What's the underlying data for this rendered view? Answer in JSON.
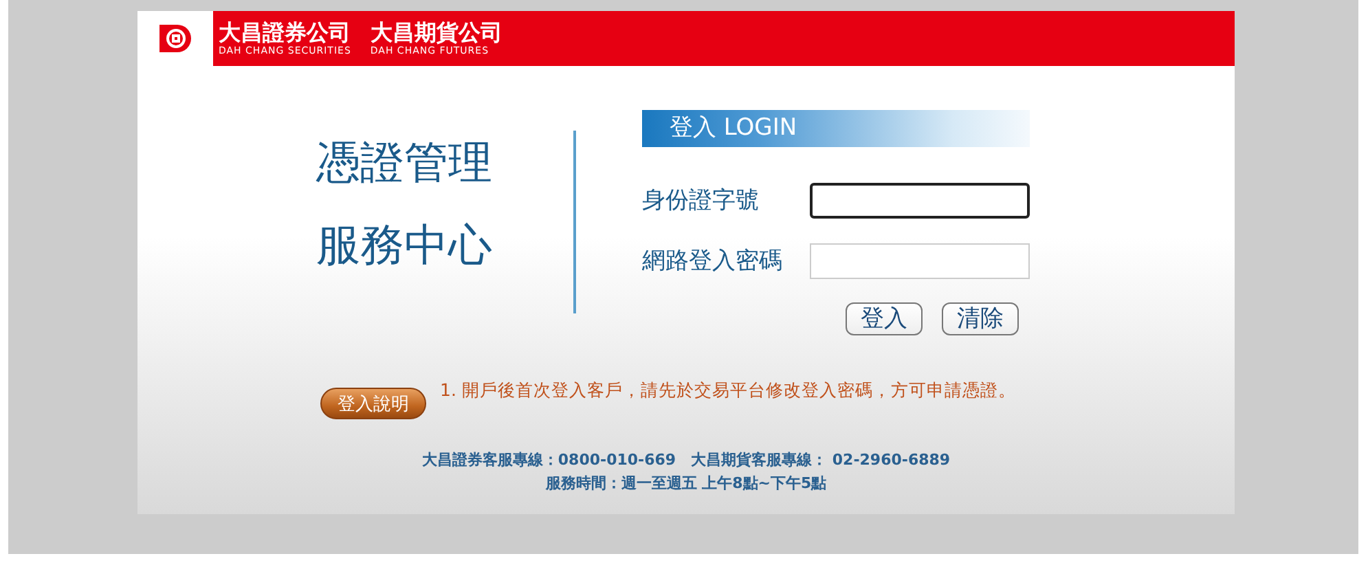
{
  "header": {
    "brands": [
      {
        "title": "大昌證券公司",
        "subtitle": "DAH CHANG SECURITIES"
      },
      {
        "title": "大昌期貨公司",
        "subtitle": "DAH CHANG FUTURES"
      }
    ]
  },
  "headline": [
    "憑證管理",
    "服務中心"
  ],
  "login": {
    "title": "登入 LOGIN",
    "fields": [
      {
        "label": "身份證字號",
        "focused": true
      },
      {
        "label": "網路登入密碼",
        "focused": false
      }
    ],
    "buttons": [
      "登入",
      "清除"
    ]
  },
  "help_button": "登入說明",
  "notice": "1. 開戶後首次登入客戶，請先於交易平台修改登入密碼，方可申請憑證。",
  "footer": [
    "大昌證券客服專線：0800-010-669　大昌期貨客服專線： 02-2960-6889",
    "服務時間：週一至週五 上午8點~下午5點"
  ]
}
